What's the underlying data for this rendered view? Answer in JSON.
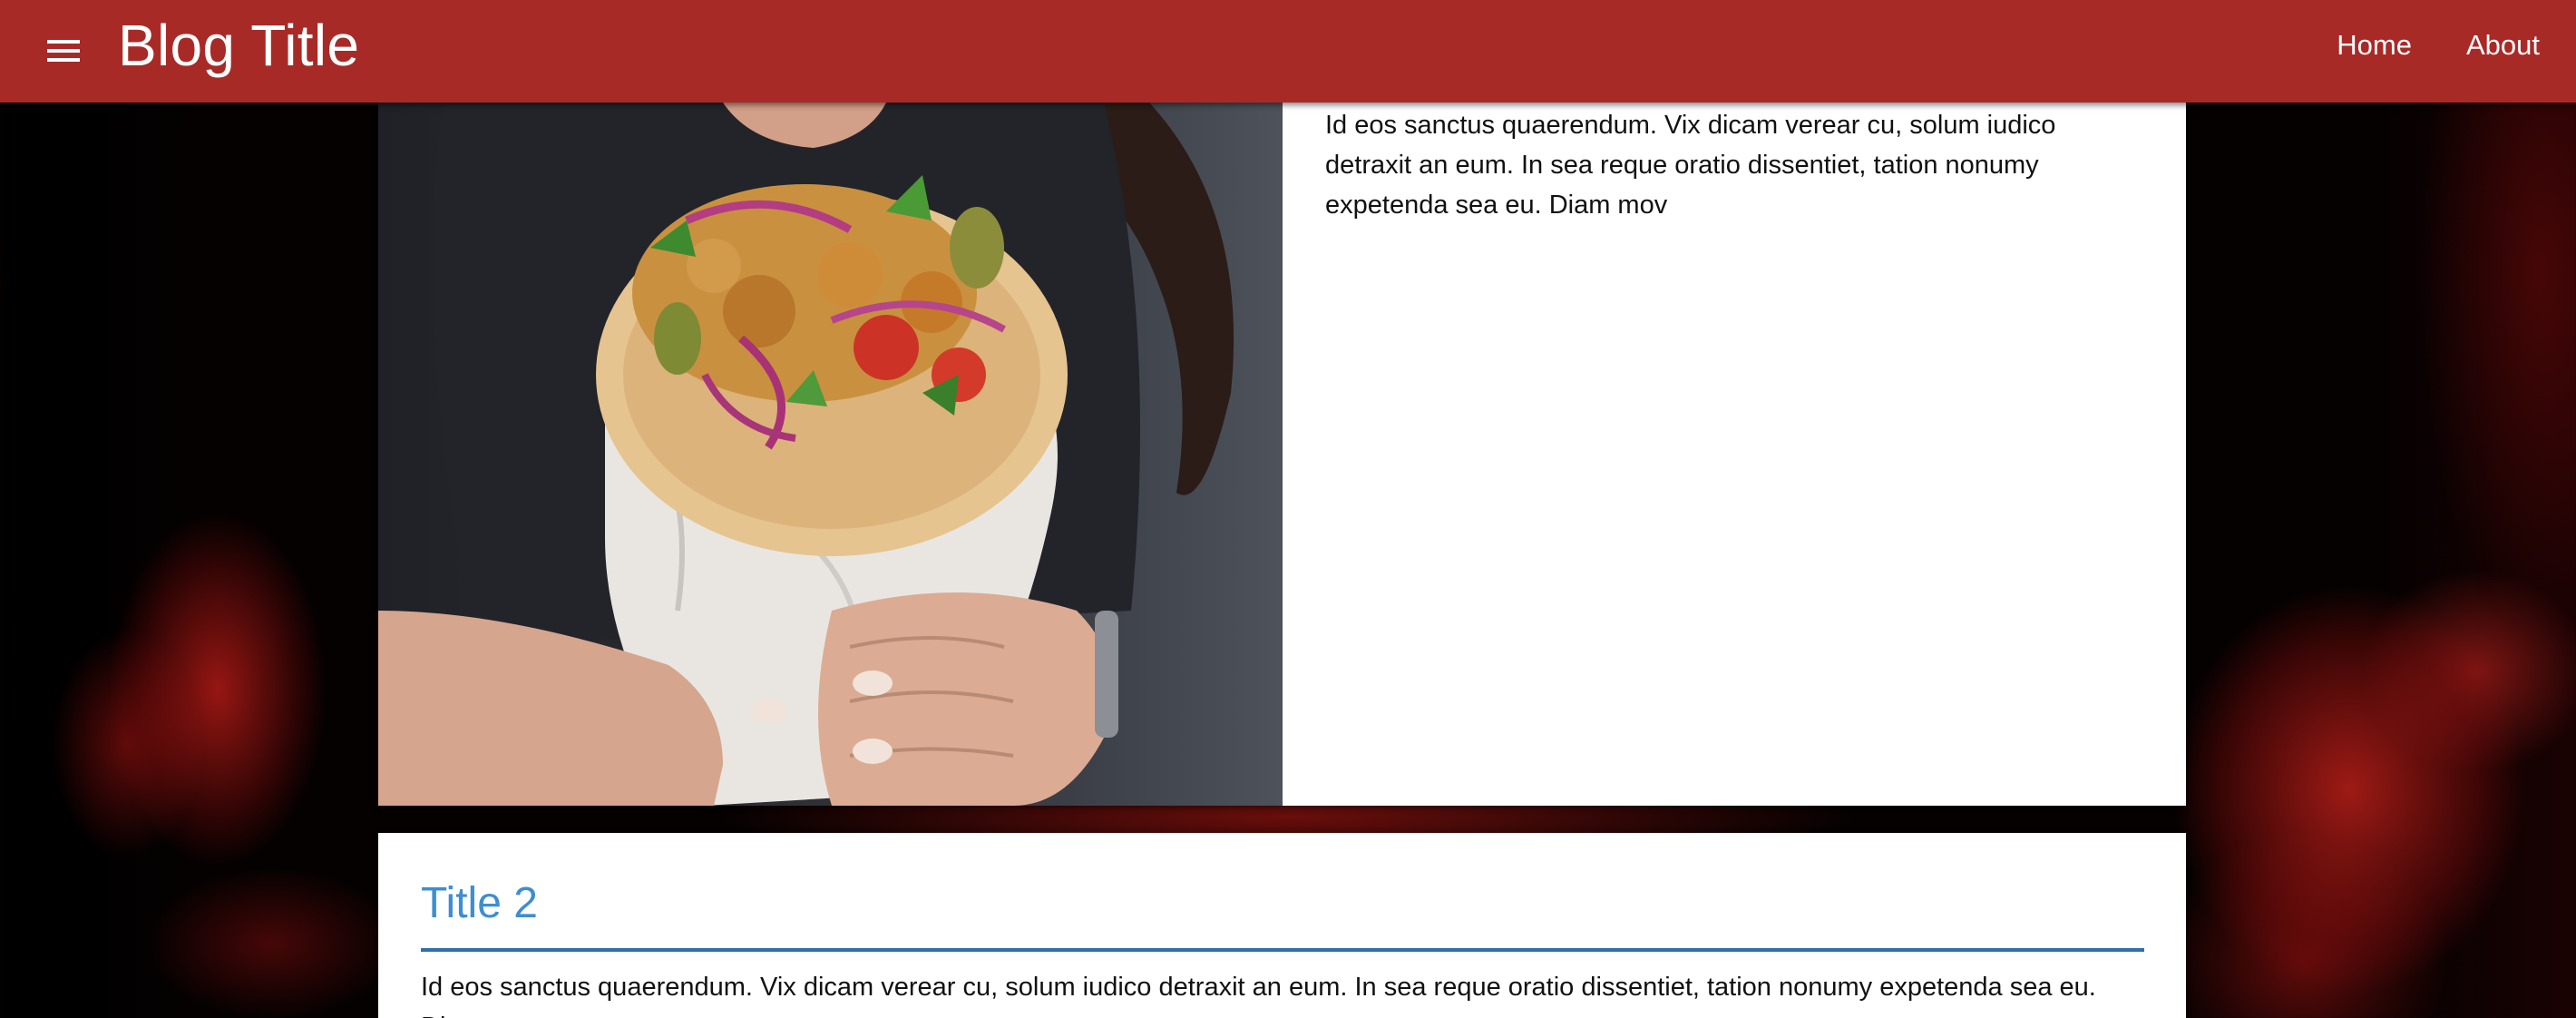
{
  "app_bar": {
    "title": "Blog Title",
    "menu_icon": "menu-icon",
    "background": "#a82a27",
    "nav": [
      {
        "label": "Home"
      },
      {
        "label": "About"
      }
    ]
  },
  "posts": [
    {
      "image": "food-photo-shawarma-wrap",
      "body": "Id eos sanctus quaerendum. Vix dicam verear cu, solum iudico detraxit an eum. In sea reque oratio dissentiet, tation nonumy expetenda sea eu. Diam mov"
    },
    {
      "title": "Title 2",
      "body": "Id eos sanctus quaerendum. Vix dicam verear cu, solum iudico detraxit an eum. In sea reque oratio dissentiet, tation nonumy expetenda sea eu. Diam mov",
      "title_color": "#3d8ed1"
    }
  ]
}
